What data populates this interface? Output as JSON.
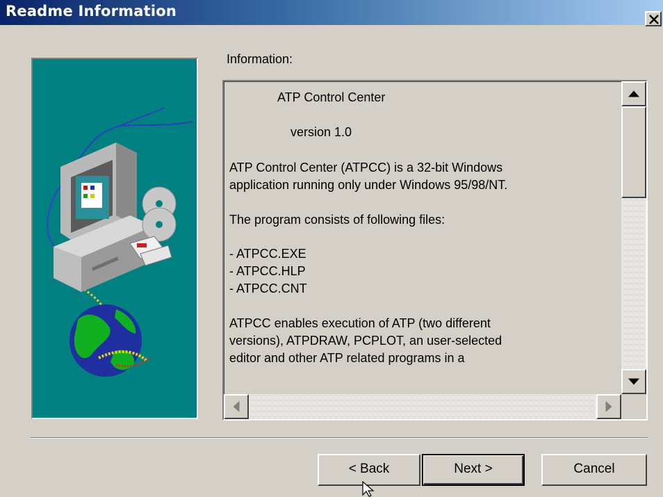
{
  "window": {
    "title": "Readme Information",
    "close_icon": "close-icon"
  },
  "content": {
    "info_label": "Information:",
    "text_lines": [
      "ATP Control Center",
      "version 1.0",
      "ATP Control Center (ATPCC) is a 32-bit Windows",
      "application running only under Windows 95/98/NT.",
      "The program consists of following files:",
      "- ATPCC.EXE",
      "- ATPCC.HLP",
      "- ATPCC.CNT",
      "ATPCC enables execution of ATP (two different",
      "versions), ATPDRAW, PCPLOT, an user-selected",
      "editor and other ATP related programs in a"
    ],
    "vertical_scroll_position": 0,
    "horizontal_scroll_position": 0
  },
  "buttons": {
    "back": "< Back",
    "next": "Next >",
    "cancel": "Cancel"
  },
  "colors": {
    "panel_background": "#008080",
    "title_start": "#0a246a",
    "title_end": "#a6caf0",
    "dialog_face": "#d4d0c8"
  },
  "icons": [
    "close-icon",
    "scroll-up-arrow-icon",
    "scroll-down-arrow-icon",
    "scroll-left-arrow-icon",
    "scroll-right-arrow-icon",
    "mouse-pointer-icon"
  ]
}
